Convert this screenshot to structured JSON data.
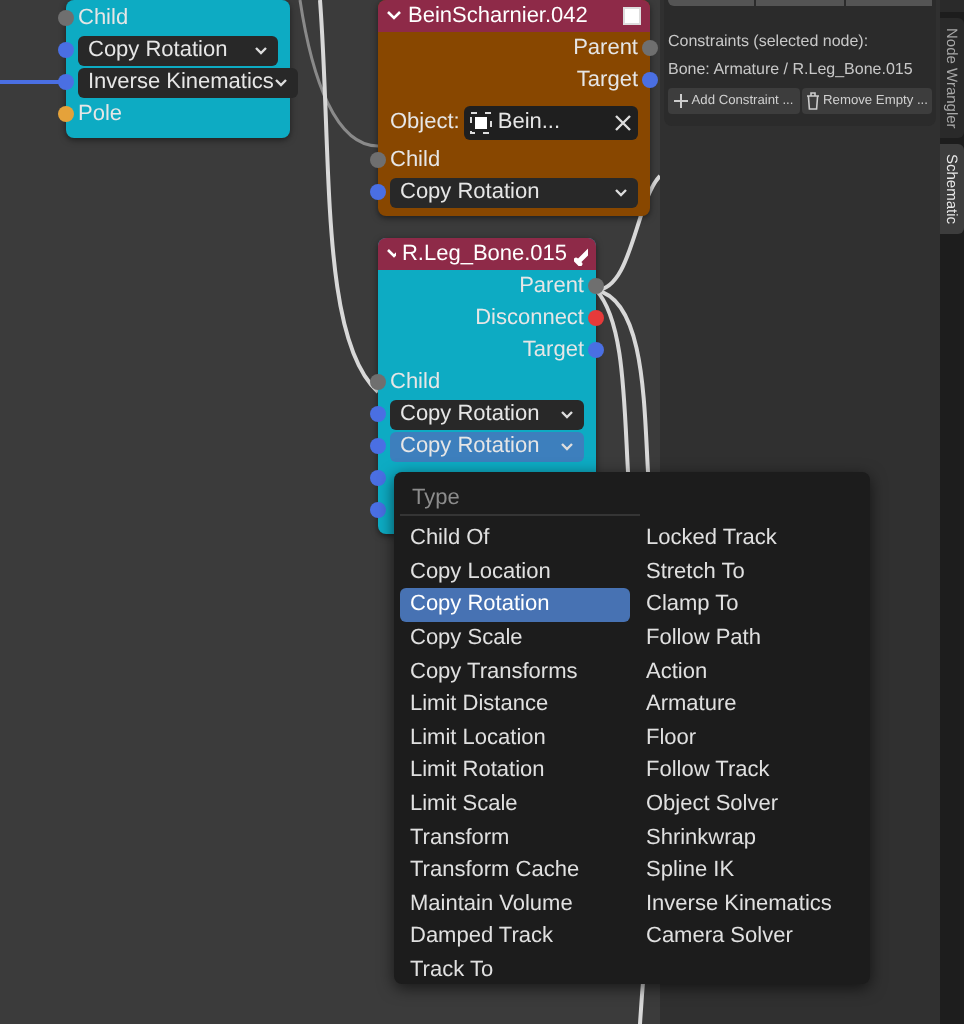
{
  "nodes": [
    {
      "color": "#0dabc3",
      "rows": [
        {
          "kind": "input",
          "label": "Child",
          "color": "#6f6f6f"
        },
        {
          "kind": "dropdown",
          "value": "Copy Rotation",
          "color": "#4a6fe3",
          "active": false
        },
        {
          "kind": "dropdown",
          "value": "Inverse Kinematics",
          "color": "#4a6fe3",
          "active": false
        },
        {
          "kind": "input",
          "label": "Pole",
          "color": "#e5a23a"
        }
      ]
    },
    {
      "title": "BeinScharnier.042",
      "color": "#884700",
      "rows": [
        {
          "kind": "output",
          "label": "Parent",
          "color": "#6f6f6f"
        },
        {
          "kind": "output",
          "label": "Target",
          "color": "#4a6fe3"
        },
        {
          "kind": "object",
          "label": "Object:",
          "value": "Bein..."
        },
        {
          "kind": "input",
          "label": "Child",
          "color": "#6f6f6f"
        },
        {
          "kind": "dropdown",
          "value": "Copy Rotation",
          "color": "#4a6fe3",
          "active": false
        }
      ]
    },
    {
      "title": "R.Leg_Bone.015",
      "color": "#0dabc3",
      "rows": [
        {
          "kind": "output",
          "label": "Parent",
          "color": "#6f6f6f"
        },
        {
          "kind": "output",
          "label": "Disconnect",
          "color": "#e63a3a"
        },
        {
          "kind": "output",
          "label": "Target",
          "color": "#4a6fe3"
        },
        {
          "kind": "input",
          "label": "Child",
          "color": "#6f6f6f"
        },
        {
          "kind": "dropdown",
          "value": "Copy Rotation",
          "color": "#4a6fe3",
          "active": false
        },
        {
          "kind": "dropdown",
          "value": "Copy Rotation",
          "color": "#4a6fe3",
          "active": true
        },
        {
          "kind": "socket",
          "color": "#4a6fe3"
        },
        {
          "kind": "socket",
          "color": "#4a6fe3"
        }
      ]
    }
  ],
  "menu": {
    "title": "Type",
    "columns": [
      [
        {
          "label": "Child Of",
          "selected": false
        },
        {
          "label": "Copy Location",
          "selected": false
        },
        {
          "label": "Copy Rotation",
          "selected": true
        },
        {
          "label": "Copy Scale",
          "selected": false
        },
        {
          "label": "Copy Transforms",
          "selected": false
        },
        {
          "label": "Limit Distance",
          "selected": false
        },
        {
          "label": "Limit Location",
          "selected": false
        },
        {
          "label": "Limit Rotation",
          "selected": false
        },
        {
          "label": "Limit Scale",
          "selected": false
        },
        {
          "label": "Transform",
          "selected": false
        },
        {
          "label": "Transform Cache",
          "selected": false
        },
        {
          "label": "Maintain Volume",
          "selected": false
        },
        {
          "label": "Damped Track",
          "selected": false
        },
        {
          "label": "Track To",
          "selected": false
        }
      ],
      [
        {
          "label": "Locked Track",
          "selected": false
        },
        {
          "label": "Stretch To",
          "selected": false
        },
        {
          "label": "Clamp To",
          "selected": false
        },
        {
          "label": "Follow Path",
          "selected": false
        },
        {
          "label": "Action",
          "selected": false
        },
        {
          "label": "Armature",
          "selected": false
        },
        {
          "label": "Floor",
          "selected": false
        },
        {
          "label": "Follow Track",
          "selected": false
        },
        {
          "label": "Object Solver",
          "selected": false
        },
        {
          "label": "Shrinkwrap",
          "selected": false
        },
        {
          "label": "Spline IK",
          "selected": false
        },
        {
          "label": "Inverse Kinematics",
          "selected": false
        },
        {
          "label": "Camera Solver",
          "selected": false
        }
      ]
    ]
  },
  "panel": {
    "heading": "Constraints (selected node):",
    "bone": "Bone: Armature / R.Leg_Bone.015",
    "buttons": [
      {
        "label": "Add Constraint ..."
      },
      {
        "label": "Remove Empty ..."
      }
    ]
  },
  "sidebar_tabs": [
    {
      "label": "Node Wrangler",
      "selected": false
    },
    {
      "label": "Schematic",
      "selected": true
    }
  ]
}
